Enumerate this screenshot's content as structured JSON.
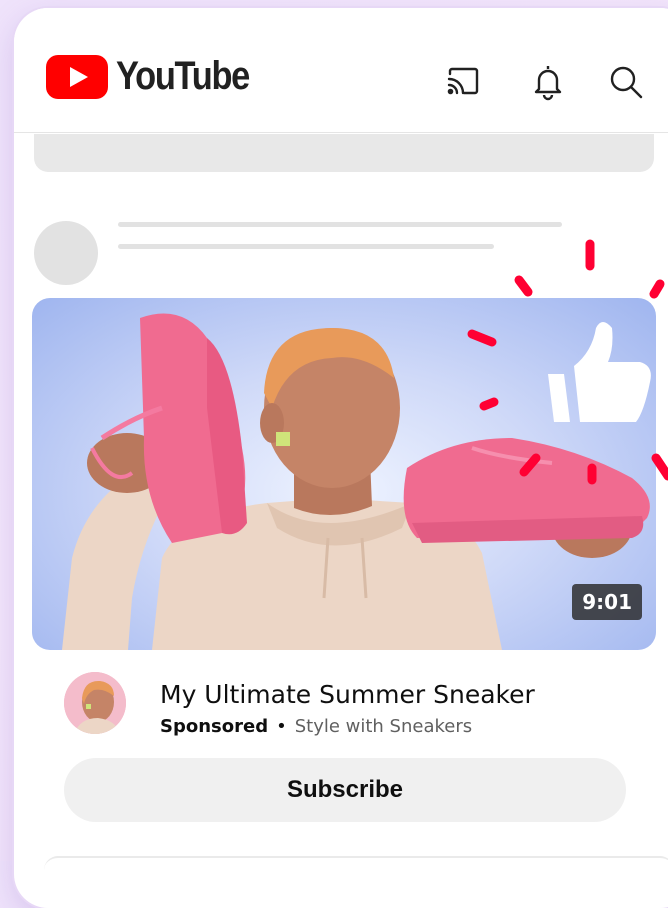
{
  "header": {
    "brand": "YouTube",
    "icons": [
      "cast-icon",
      "bell-icon",
      "search-icon"
    ]
  },
  "video": {
    "duration": "9:01",
    "title": "My Ultimate Summer Sneaker",
    "sponsored_label": "Sponsored",
    "separator": "•",
    "channel": "Style with Sneakers"
  },
  "subscribe_label": "Subscribe",
  "colors": {
    "brand_red": "#ff0000",
    "accent_red": "#ff0033",
    "sneaker_pink": "#f36f93",
    "page_bg": "#efe3fb"
  }
}
